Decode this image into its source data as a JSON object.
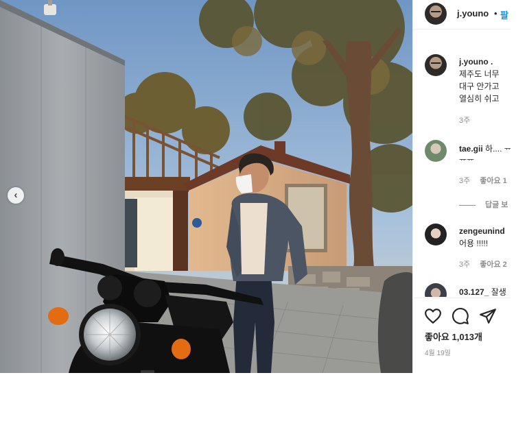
{
  "post": {
    "author": "j.youno",
    "dot": "•",
    "follow_label": "팔"
  },
  "comments": [
    {
      "user": "j.youno",
      "user_suffix": ".",
      "lines": [
        "제주도 너무",
        "대구 안가고",
        "열심히 쉬고"
      ],
      "time": "3주",
      "likes": ""
    },
    {
      "user": "tae.gii",
      "lines": [
        "하.... ᅲ",
        "ᅲᅲ"
      ],
      "time": "3주",
      "likes": "좋아요 1",
      "replies": "답글 보"
    },
    {
      "user": "zengeunind",
      "lines": [
        "어용 !!!!!"
      ],
      "time": "3주",
      "likes": "좋아요 2"
    },
    {
      "user": "03.127_",
      "lines": [
        "잘생"
      ],
      "time": "",
      "likes": ""
    }
  ],
  "actions": {
    "like_icon": "heart-icon",
    "comment_icon": "comment-icon",
    "share_icon": "paper-plane-icon"
  },
  "likes_total": "좋아요 1,013개",
  "date": "4월 19일",
  "carousel": {
    "prev_icon": "chevron-left-icon",
    "prev_glyph": "‹"
  }
}
